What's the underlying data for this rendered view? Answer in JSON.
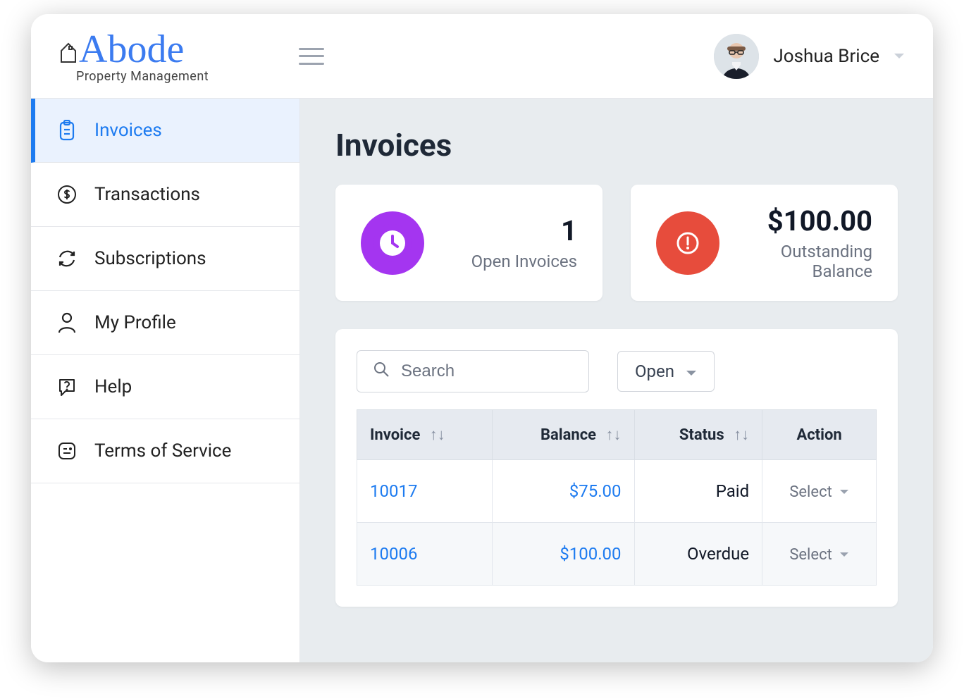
{
  "header": {
    "brand_main": "Abode",
    "brand_sub": "Property Management",
    "user_name": "Joshua Brice"
  },
  "sidebar": {
    "items": [
      {
        "label": "Invoices"
      },
      {
        "label": "Transactions"
      },
      {
        "label": "Subscriptions"
      },
      {
        "label": "My Profile"
      },
      {
        "label": "Help"
      },
      {
        "label": "Terms of Service"
      }
    ]
  },
  "main": {
    "title": "Invoices",
    "cards": [
      {
        "value": "1",
        "label": "Open Invoices"
      },
      {
        "value": "$100.00",
        "label": "Outstanding Balance"
      }
    ],
    "search_placeholder": "Search",
    "filter_label": "Open",
    "columns": {
      "invoice": "Invoice",
      "balance": "Balance",
      "status": "Status",
      "action": "Action"
    },
    "action_label": "Select",
    "rows": [
      {
        "invoice": "10017",
        "balance": "$75.00",
        "status": "Paid"
      },
      {
        "invoice": "10006",
        "balance": "$100.00",
        "status": "Overdue"
      }
    ]
  }
}
